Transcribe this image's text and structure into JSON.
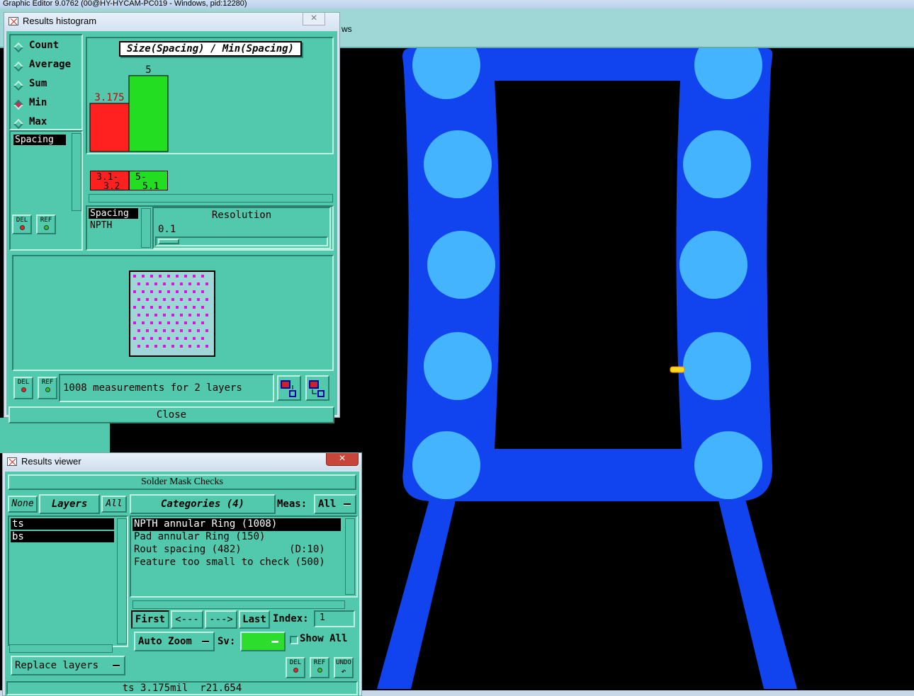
{
  "app": {
    "title": "Graphic Editor 9.0762 (00@HY-HYCAM-PC019 - Windows, pid:12280)",
    "menu_fragment": "ws"
  },
  "histogram_window": {
    "title": "Results histogram",
    "close_glyph": "×",
    "modes": [
      {
        "label": "Count",
        "selected": false
      },
      {
        "label": "Average",
        "selected": false
      },
      {
        "label": "Sum",
        "selected": false
      },
      {
        "label": "Min",
        "selected": true
      },
      {
        "label": "Max",
        "selected": false
      }
    ],
    "measure_list": [
      "Spacing"
    ],
    "del_label": "DEL",
    "ref_label": "REF",
    "chart_title": "Size(Spacing) / Min(Spacing)",
    "bin_list": [
      "Spacing",
      "NPTH"
    ],
    "resolution_label": "Resolution",
    "resolution_value": "0.1",
    "status_text": "1008 measurements for 2 layers",
    "close_button": "Close"
  },
  "chart_data": {
    "type": "bar",
    "title": "Size(Spacing) / Min(Spacing)",
    "categories": [
      "3.1-3.2",
      "5-5.1"
    ],
    "category_lines": [
      [
        "3.1-",
        "3.2"
      ],
      [
        "5-",
        "5.1"
      ]
    ],
    "values": [
      3.175,
      5
    ],
    "value_labels": [
      "3.175",
      "5"
    ],
    "colors": [
      "#ff2020",
      "#22dd22"
    ],
    "label_colors": [
      "#cc0000",
      "#000000"
    ],
    "ylim": [
      0,
      5.6
    ]
  },
  "viewer_window": {
    "title": "Results viewer",
    "close_glyph": "×",
    "header": "Solder Mask Checks",
    "none_label": "None",
    "layers_label": "Layers",
    "all_label": "All",
    "layers": [
      "ts",
      "bs"
    ],
    "categories_label": "Categories (4)",
    "meas_label": "Meas:",
    "meas_value": "All",
    "categories": [
      {
        "text": "NPTH annular Ring (1008)",
        "selected": true
      },
      {
        "text": "Pad annular Ring (150)",
        "selected": false
      },
      {
        "text": "Rout spacing (482)        (D:10)",
        "selected": false
      },
      {
        "text": "Feature too small to check (500)",
        "selected": false
      }
    ],
    "nav": {
      "first": "First",
      "prev": "<---",
      "next": "--->",
      "last": "Last"
    },
    "index_label": "Index:",
    "index_value": "1",
    "auto_zoom": "Auto Zoom",
    "sv_label": "Sv:",
    "show_all": "Show All",
    "replace_layers": "Replace layers",
    "del_label": "DEL",
    "ref_label": "REF",
    "undo_label": "UNDO",
    "status_line": "ts 3.175mil  r21.654"
  },
  "colors": {
    "teal": "#52c9ad",
    "board_blue": "#1144ee",
    "pad_light": "#44b4ff",
    "marker_yellow": "#ffd820"
  }
}
